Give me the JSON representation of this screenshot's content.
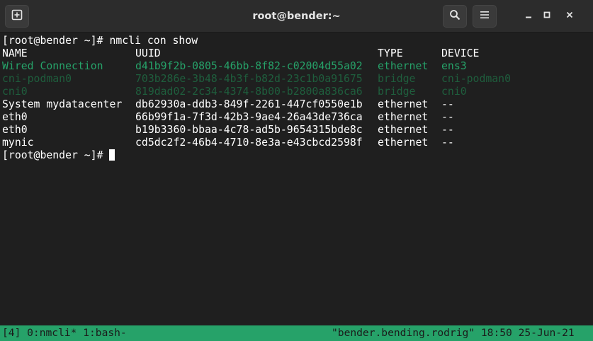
{
  "window": {
    "title": "root@bender:~"
  },
  "colors": {
    "background": "#1f1f1f",
    "titlebar": "#2c2c2c",
    "text": "#ffffff",
    "active_connection": "#26a269",
    "inactive_connection": "#1f5e3d",
    "status_bar": "#26a269"
  },
  "icons": {
    "new_tab": "new-tab-icon",
    "search": "search-icon",
    "menu": "hamburger-menu-icon",
    "minimize": "minimize-icon",
    "maximize": "maximize-icon",
    "close": "close-icon"
  },
  "terminal": {
    "command_line": "[root@bender ~]# nmcli con show",
    "headers": {
      "name": "NAME",
      "uuid": "UUID",
      "type": "TYPE",
      "device": "DEVICE"
    },
    "rows": [
      {
        "name": "Wired Connection",
        "uuid": "d41b9f2b-0805-46bb-8f82-c02004d55a02",
        "type": "ethernet",
        "device": "ens3",
        "state": "active"
      },
      {
        "name": "cni-podman0",
        "uuid": "703b286e-3b48-4b3f-b82d-23c1b0a91675",
        "type": "bridge",
        "device": "cni-podman0",
        "state": "dim"
      },
      {
        "name": "cni0",
        "uuid": "819dad02-2c34-4374-8b00-b2800a836ca6",
        "type": "bridge",
        "device": "cni0",
        "state": "dim"
      },
      {
        "name": "System mydatacenter",
        "uuid": "db62930a-ddb3-849f-2261-447cf0550e1b",
        "type": "ethernet",
        "device": "--",
        "state": "normal"
      },
      {
        "name": "eth0",
        "uuid": "66b99f1a-7f3d-42b3-9ae4-26a43de736ca",
        "type": "ethernet",
        "device": "--",
        "state": "normal"
      },
      {
        "name": "eth0",
        "uuid": "b19b3360-bbaa-4c78-ad5b-9654315bde8c",
        "type": "ethernet",
        "device": "--",
        "state": "normal"
      },
      {
        "name": "mynic",
        "uuid": "cd5dc2f2-46b4-4710-8e3a-e43cbcd2598f",
        "type": "ethernet",
        "device": "--",
        "state": "normal"
      }
    ],
    "prompt": "[root@bender ~]# "
  },
  "statusbar": {
    "left": "[4] 0:nmcli* 1:bash-",
    "right": "\"bender.bending.rodrig\" 18:50 25-Jun-21"
  }
}
